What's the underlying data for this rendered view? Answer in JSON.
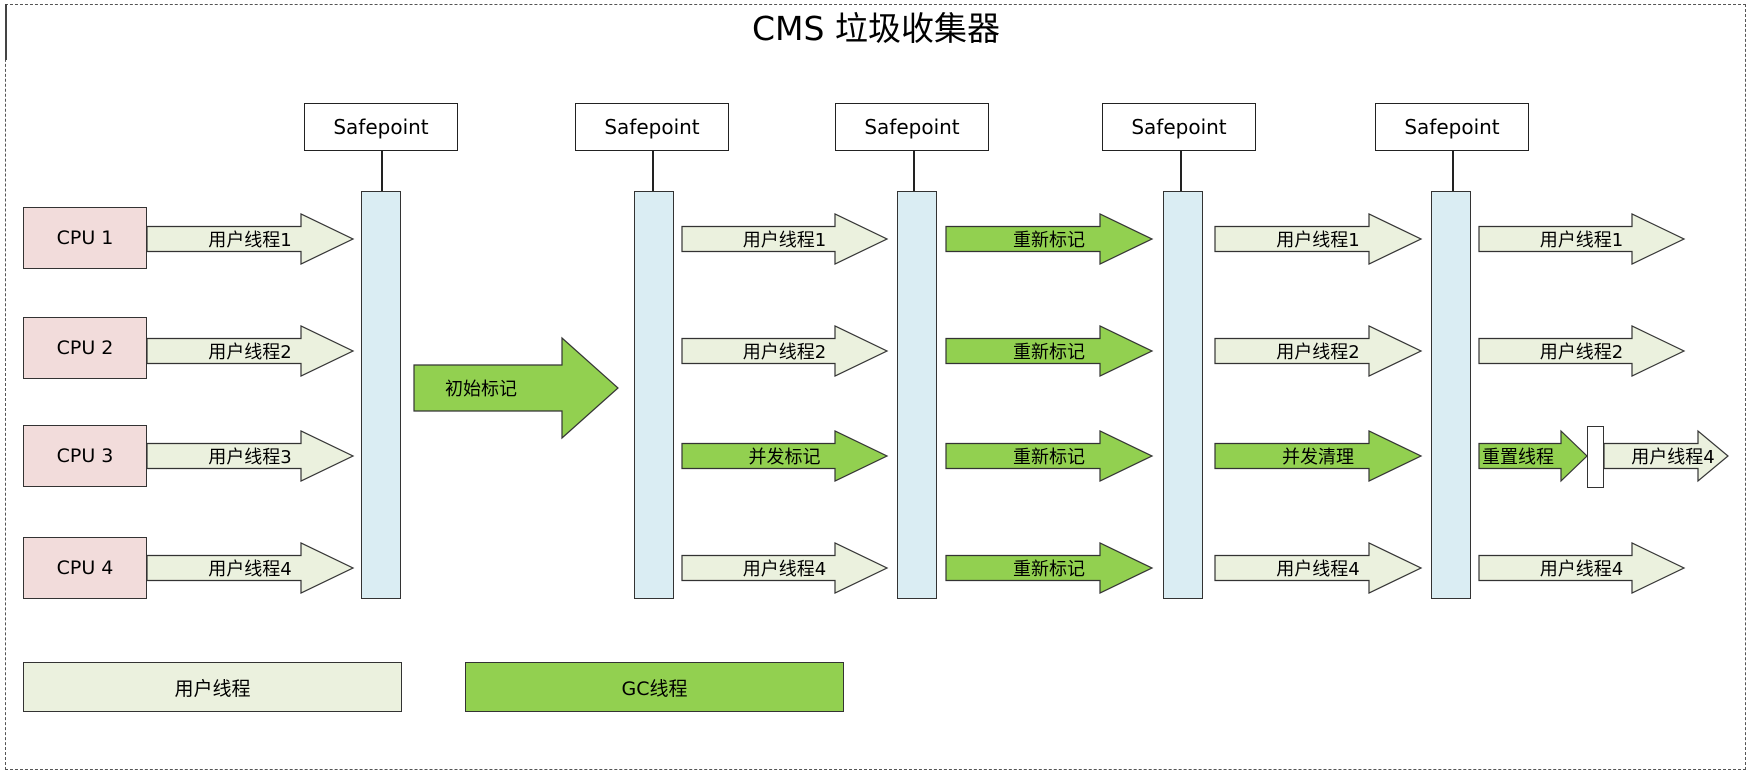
{
  "title": "CMS 垃圾收集器",
  "colors": {
    "user_thread": "#ebf1de",
    "gc_thread": "#92d050",
    "safepoint_bar": "#daedf3",
    "cpu_box": "#f2dcdb"
  },
  "safepoints": [
    {
      "label": "Safepoint"
    },
    {
      "label": "Safepoint"
    },
    {
      "label": "Safepoint"
    },
    {
      "label": "Safepoint"
    },
    {
      "label": "Safepoint"
    }
  ],
  "cpus": [
    {
      "label": "CPU 1"
    },
    {
      "label": "CPU 2"
    },
    {
      "label": "CPU 3"
    },
    {
      "label": "CPU 4"
    }
  ],
  "phase0": {
    "arrows": [
      {
        "label": "用户线程1",
        "kind": "user"
      },
      {
        "label": "用户线程2",
        "kind": "user"
      },
      {
        "label": "用户线程3",
        "kind": "user"
      },
      {
        "label": "用户线程4",
        "kind": "user"
      }
    ]
  },
  "initial_mark": {
    "label": "初始标记",
    "kind": "gc"
  },
  "phase2": {
    "arrows": [
      {
        "label": "用户线程1",
        "kind": "user"
      },
      {
        "label": "用户线程2",
        "kind": "user"
      },
      {
        "label": "并发标记",
        "kind": "gc"
      },
      {
        "label": "用户线程4",
        "kind": "user"
      }
    ]
  },
  "phase3": {
    "arrows": [
      {
        "label": "重新标记",
        "kind": "gc"
      },
      {
        "label": "重新标记",
        "kind": "gc"
      },
      {
        "label": "重新标记",
        "kind": "gc"
      },
      {
        "label": "重新标记",
        "kind": "gc"
      }
    ]
  },
  "phase4": {
    "arrows": [
      {
        "label": "用户线程1",
        "kind": "user"
      },
      {
        "label": "用户线程2",
        "kind": "user"
      },
      {
        "label": "并发清理",
        "kind": "gc"
      },
      {
        "label": "用户线程4",
        "kind": "user"
      }
    ]
  },
  "phase5": {
    "arrows": [
      {
        "label": "用户线程1",
        "kind": "user"
      },
      {
        "label": "用户线程2",
        "kind": "user"
      },
      {
        "label": "重置线程",
        "kind": "gc"
      },
      {
        "label": "用户线程4",
        "kind": "user"
      }
    ],
    "extra_arrow": {
      "label": "用户线程4",
      "kind": "user"
    }
  },
  "legend": {
    "user": {
      "label": "用户线程",
      "kind": "user"
    },
    "gc": {
      "label": "GC线程",
      "kind": "gc"
    }
  }
}
